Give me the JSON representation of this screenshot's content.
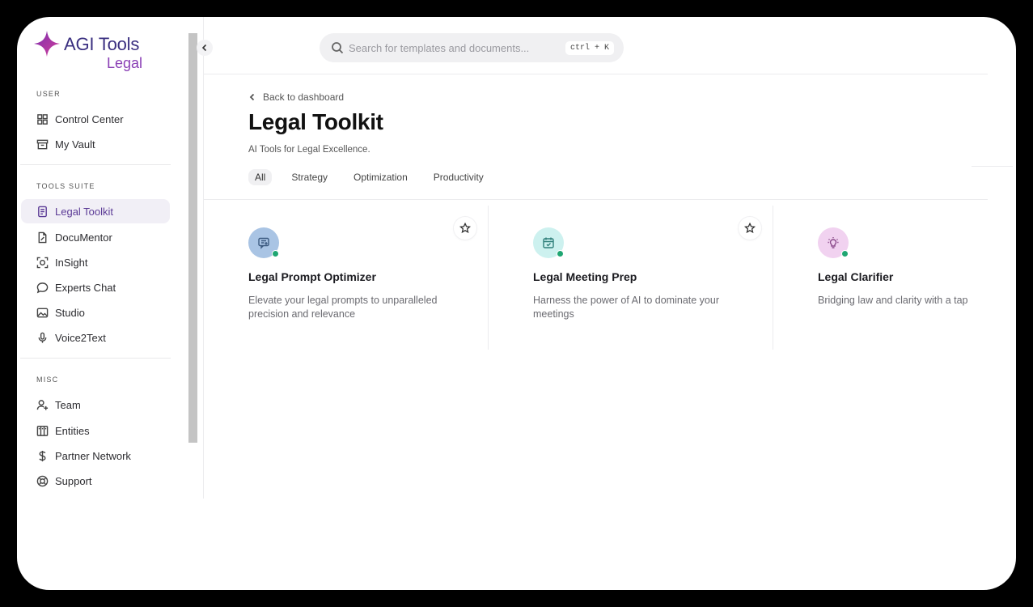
{
  "brand": {
    "title": "AGI Tools",
    "subtitle": "Legal"
  },
  "sidebar": {
    "sections": [
      {
        "label": "USER",
        "items": [
          {
            "label": "Control Center",
            "icon": "grid-icon"
          },
          {
            "label": "My Vault",
            "icon": "archive-icon"
          }
        ]
      },
      {
        "label": "TOOLS SUITE",
        "items": [
          {
            "label": "Legal Toolkit",
            "icon": "document-icon",
            "active": true
          },
          {
            "label": "DocuMentor",
            "icon": "file-edit-icon"
          },
          {
            "label": "InSight",
            "icon": "scan-face-icon"
          },
          {
            "label": "Experts Chat",
            "icon": "chat-bubble-icon"
          },
          {
            "label": "Studio",
            "icon": "image-icon"
          },
          {
            "label": "Voice2Text",
            "icon": "microphone-icon"
          }
        ]
      },
      {
        "label": "MISC",
        "items": [
          {
            "label": "Team",
            "icon": "user-plus-icon"
          },
          {
            "label": "Entities",
            "icon": "columns-icon"
          },
          {
            "label": "Partner Network",
            "icon": "dollar-icon"
          },
          {
            "label": "Support",
            "icon": "lifebuoy-icon"
          }
        ]
      }
    ]
  },
  "search": {
    "placeholder": "Search for templates and documents...",
    "shortcut": "ctrl + K"
  },
  "header": {
    "back_label": "Back to dashboard",
    "title": "Legal Toolkit",
    "subtitle": "AI Tools for Legal Excellence."
  },
  "tabs": [
    {
      "label": "All",
      "active": true
    },
    {
      "label": "Strategy"
    },
    {
      "label": "Optimization"
    },
    {
      "label": "Productivity"
    }
  ],
  "cards": [
    {
      "title": "Legal Prompt Optimizer",
      "description": "Elevate your legal prompts to unparalleled precision and relevance",
      "icon": "message-plus-icon",
      "icon_bg": "#a9c4e4",
      "icon_color": "#3c5a80"
    },
    {
      "title": "Legal Meeting Prep",
      "description": "Harness the power of AI to dominate your meetings",
      "icon": "calendar-check-icon",
      "icon_bg": "#cdf1ef",
      "icon_color": "#2f7f7a"
    },
    {
      "title": "Legal Clarifier",
      "description": "Bridging law and clarity with a tap",
      "icon": "lightbulb-icon",
      "icon_bg": "#f1d2f0",
      "icon_color": "#8a4b8a"
    }
  ],
  "colors": {
    "accent": "#5b3a96",
    "status_online": "#1fa672",
    "logo_purple": "#8a3fb5"
  }
}
